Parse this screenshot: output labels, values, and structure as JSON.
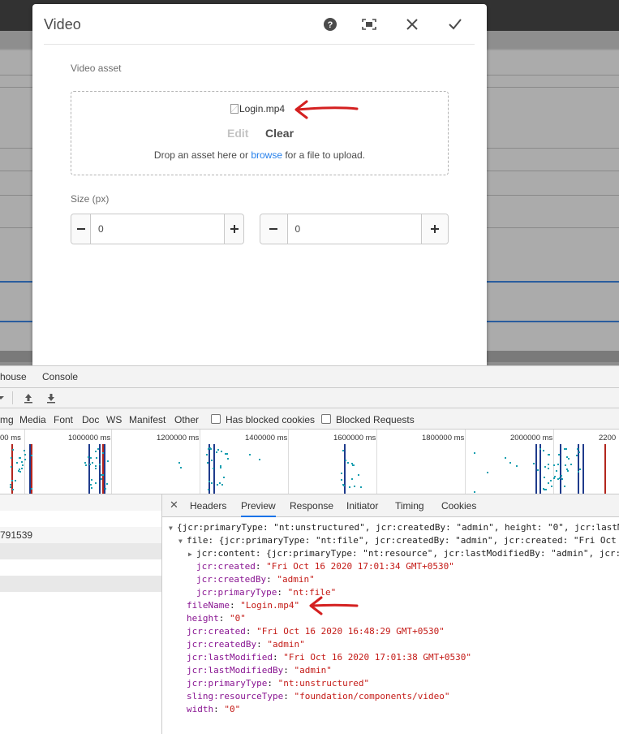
{
  "dialog": {
    "title": "Video",
    "icons": {
      "help": "help-icon",
      "fullscreen": "fullscreen-icon",
      "close": "close-icon",
      "done": "checkmark-icon"
    },
    "asset_label": "Video asset",
    "asset_image_alt": "Login.mp4",
    "edit_label": "Edit",
    "clear_label": "Clear",
    "drop_hint_before": "Drop an asset here or ",
    "drop_hint_link": "browse",
    "drop_hint_after": " for a file to upload.",
    "size_label": "Size (px)",
    "width_value": "0",
    "height_value": "0"
  },
  "devtools": {
    "tabs": [
      "house",
      "Console"
    ],
    "filters": [
      "mg",
      "Media",
      "Font",
      "Doc",
      "WS",
      "Manifest",
      "Other"
    ],
    "has_blocked_cookies": "Has blocked cookies",
    "blocked_requests": "Blocked Requests",
    "timeline_labels": [
      "00 ms",
      "1000000 ms",
      "1200000 ms",
      "1400000 ms",
      "1600000 ms",
      "1800000 ms",
      "2000000 ms",
      "2200"
    ],
    "left_row_text": "791539",
    "detail_tabs": [
      "Headers",
      "Preview",
      "Response",
      "Initiator",
      "Timing",
      "Cookies"
    ],
    "active_tab": "Preview",
    "json_lines": [
      "{jcr:primaryType: \"nt:unstructured\", jcr:createdBy: \"admin\", height: \"0\", jcr:lastM",
      "file: {jcr:primaryType: \"nt:file\", jcr:createdBy: \"admin\", jcr:created: \"Fri Oct",
      "jcr:content: {jcr:primaryType: \"nt:resource\", jcr:lastModifiedBy: \"admin\", jcr:"
    ],
    "file_created": {
      "key": "jcr:created",
      "value": "\"Fri Oct 16 2020 17:01:34 GMT+0530\""
    },
    "file_createdBy": {
      "key": "jcr:createdBy",
      "value": "\"admin\""
    },
    "file_primaryType": {
      "key": "jcr:primaryType",
      "value": "\"nt:file\""
    },
    "fileName": {
      "key": "fileName",
      "value": "\"Login.mp4\""
    },
    "height": {
      "key": "height",
      "value": "\"0\""
    },
    "created": {
      "key": "jcr:created",
      "value": "\"Fri Oct 16 2020 16:48:29 GMT+0530\""
    },
    "createdBy": {
      "key": "jcr:createdBy",
      "value": "\"admin\""
    },
    "lastModified": {
      "key": "jcr:lastModified",
      "value": "\"Fri Oct 16 2020 17:01:38 GMT+0530\""
    },
    "lastModifiedBy": {
      "key": "jcr:lastModifiedBy",
      "value": "\"admin\""
    },
    "primaryType": {
      "key": "jcr:primaryType",
      "value": "\"nt:unstructured\""
    },
    "resourceType": {
      "key": "sling:resourceType",
      "value": "\"foundation/components/video\""
    },
    "width": {
      "key": "width",
      "value": "\"0\""
    }
  },
  "colors": {
    "annotation_arrow": "#d42020",
    "link": "#2680eb",
    "json_key": "#881391",
    "json_string": "#c41a16"
  }
}
